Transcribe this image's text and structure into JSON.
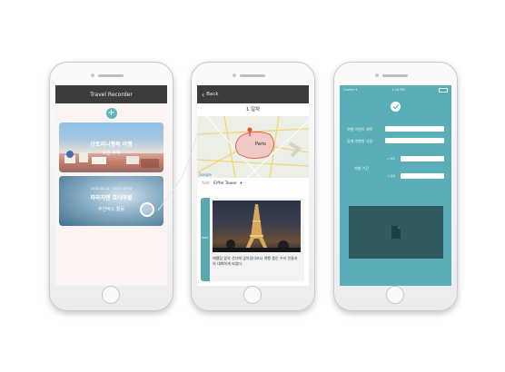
{
  "phone1": {
    "nav_title": "Travel Recorder",
    "add_symbol": "+",
    "card1": {
      "title": "산토리니행복 여행",
      "sub": "오늘 추억"
    },
    "card2": {
      "title": "파라지엔 호나우블",
      "date": "2015.10.10 ~ 2015.10.15",
      "sub": "추천박스 활동"
    }
  },
  "phone2": {
    "back_label": "Back",
    "day_title": "1 일차",
    "map_labels": {
      "paris": "Paris",
      "google": "Google"
    },
    "poi": {
      "prefix": "Add",
      "name": "Eiffel Tower",
      "arrow": "▾"
    },
    "stripe_label": "Add",
    "entry_text": "에펠탑 앞의 선디에 앉아있다보니 여행 중인 우리 인들과의 대화하게 되었다."
  },
  "phone3": {
    "status": {
      "left": "Carrier ✈",
      "center": "1:16 PM"
    },
    "fields": [
      {
        "label": "여행 이벤트 제목"
      },
      {
        "label": "함께 여행한 사람"
      },
      {
        "label": "여행 기간",
        "sub1": "시 부터",
        "sub2": "시 까지"
      }
    ]
  },
  "colors": {
    "teal": "#5aaeb8",
    "navbar": "#3c3c3c",
    "stripe": "#5aa8b0"
  }
}
